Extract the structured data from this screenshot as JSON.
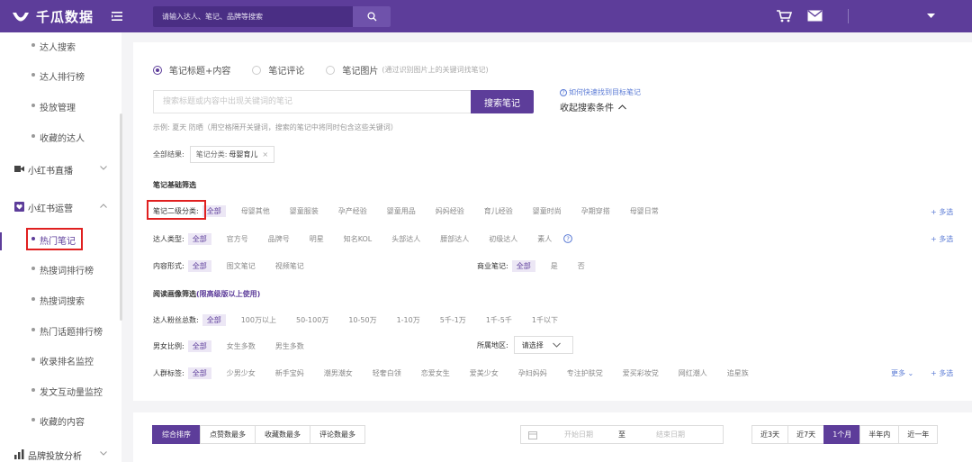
{
  "app": {
    "name": "千瓜数据"
  },
  "topbar": {
    "search_placeholder": "请输入达人、笔记、品牌等搜索"
  },
  "sidebar": {
    "items": [
      {
        "label": "达人搜索"
      },
      {
        "label": "达人排行榜"
      },
      {
        "label": "投放管理"
      },
      {
        "label": "收藏的达人"
      }
    ],
    "group_live": {
      "label": "小红书直播"
    },
    "group_ops": {
      "label": "小红书运营"
    },
    "ops_items": [
      {
        "label": "热门笔记",
        "active": true
      },
      {
        "label": "热搜词排行榜"
      },
      {
        "label": "热搜词搜索"
      },
      {
        "label": "热门话题排行榜"
      },
      {
        "label": "收录排名监控"
      },
      {
        "label": "发文互动量监控"
      },
      {
        "label": "收藏的内容"
      }
    ],
    "group_brand": {
      "label": "品牌投放分析"
    }
  },
  "filter": {
    "radios": [
      {
        "label": "笔记标题+内容",
        "checked": true
      },
      {
        "label": "笔记评论",
        "checked": false
      },
      {
        "label": "笔记图片",
        "hint": "(通过识别图片上的关键词找笔记)",
        "checked": false
      }
    ],
    "search_placeholder": "搜索标题或内容中出现关键词的笔记",
    "search_button": "搜索笔记",
    "help_link": "如何快速找到目标笔记",
    "collapse_link": "收起搜索条件",
    "example": "示例: 夏天 防晒（用空格隔开关键词，搜索的笔记中将同时包含这些关键词）",
    "result_label": "全部结果:",
    "result_tag_key": "笔记分类:",
    "result_tag_value": "母婴育儿",
    "basic_title": "笔记基础筛选",
    "category": {
      "label": "笔记二级分类:",
      "options": [
        "全部",
        "母婴其他",
        "婴童服装",
        "孕产经验",
        "婴童用品",
        "妈妈经验",
        "育儿经验",
        "婴童时尚",
        "孕期穿搭",
        "母婴日常"
      ],
      "selected": 0,
      "more": "+ 多选"
    },
    "creator_type": {
      "label": "达人类型:",
      "options": [
        "全部",
        "官方号",
        "品牌号",
        "明星",
        "知名KOL",
        "头部达人",
        "腰部达人",
        "初级达人",
        "素人"
      ],
      "selected": 0,
      "more": "+ 多选"
    },
    "content_form": {
      "label": "内容形式:",
      "options": [
        "全部",
        "图文笔记",
        "视频笔记"
      ],
      "selected": 0
    },
    "business_note": {
      "label": "商业笔记:",
      "options": [
        "全部",
        "是",
        "否"
      ],
      "selected": 0
    },
    "audience_title": "阅读画像筛选",
    "audience_title_note": "(限高级版以上使用)",
    "fans": {
      "label": "达人粉丝总数:",
      "options": [
        "全部",
        "100万以上",
        "50-100万",
        "10-50万",
        "1-10万",
        "5千-1万",
        "1千-5千",
        "1千以下"
      ],
      "selected": 0
    },
    "gender": {
      "label": "男女比例:",
      "options": [
        "全部",
        "女生多数",
        "男生多数"
      ],
      "selected": 0
    },
    "region": {
      "label": "所属地区:",
      "value": "请选择"
    },
    "crowd": {
      "label": "人群标签:",
      "options": [
        "全部",
        "少男少女",
        "新手宝妈",
        "潮男潮女",
        "轻奢白领",
        "恋爱女生",
        "爱美少女",
        "孕妇妈妈",
        "专注护肤党",
        "爱买彩妆党",
        "网红潮人",
        "追星族"
      ],
      "selected": 0,
      "expand": "更多",
      "more": "+ 多选"
    }
  },
  "sortbar": {
    "sorts": [
      "综合排序",
      "点赞数最多",
      "收藏数最多",
      "评论数最多"
    ],
    "selected": 0,
    "date_start": "开始日期",
    "date_sep": "至",
    "date_end": "结束日期",
    "ranges": [
      "近3天",
      "近7天",
      "1个月",
      "半年内",
      "近一年"
    ],
    "range_selected": 2
  },
  "colors": {
    "brand": "#5d3d9a",
    "highlight": "#e02020",
    "link": "#5b7bd5"
  }
}
